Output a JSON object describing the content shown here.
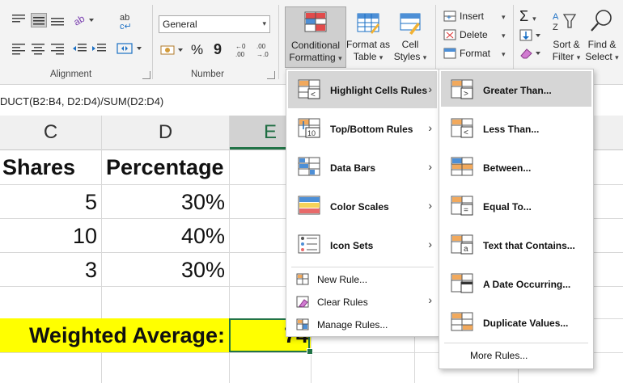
{
  "ribbon": {
    "alignment_label": "Alignment",
    "number_label": "Number",
    "number_format": "General",
    "currency_symbol": "$",
    "percent_symbol": "%",
    "comma_symbol": "9",
    "cf_line1": "Conditional",
    "cf_line2": "Formatting",
    "fat_line1": "Format as",
    "fat_line2": "Table",
    "cs_line1": "Cell",
    "cs_line2": "Styles",
    "insert": "Insert",
    "delete": "Delete",
    "format": "Format",
    "sort_line1": "Sort &",
    "sort_line2": "Filter",
    "find_line1": "Find &",
    "find_line2": "Select"
  },
  "formula_bar": {
    "text": "DUCT(B2:B4, D2:D4)/SUM(D2:D4)"
  },
  "columns": [
    "C",
    "D",
    "E"
  ],
  "sheet": {
    "header_c": "Shares",
    "header_d": "Percentage",
    "rows": [
      {
        "c": "5",
        "d": "30%"
      },
      {
        "c": "10",
        "d": "40%"
      },
      {
        "c": "3",
        "d": "30%"
      }
    ],
    "weighted_label": "Weighted Average:",
    "weighted_value": "74"
  },
  "cf_menu": {
    "items": [
      "Highlight Cells Rules",
      "Top/Bottom Rules",
      "Data Bars",
      "Color Scales",
      "Icon Sets",
      "New Rule...",
      "Clear Rules",
      "Manage Rules..."
    ]
  },
  "hcr_menu": {
    "items": [
      "Greater Than...",
      "Less Than...",
      "Between...",
      "Equal To...",
      "Text that Contains...",
      "A Date Occurring...",
      "Duplicate Values...",
      "More Rules..."
    ]
  },
  "colors": {
    "accent": "#217346",
    "highlight": "#ffff00",
    "menu_hover": "#d6d6d6"
  }
}
